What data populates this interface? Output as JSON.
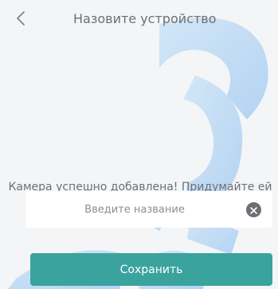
{
  "header": {
    "back_icon": "chevron-left-icon",
    "title": "Назовите устройство"
  },
  "main": {
    "message": "Камера успешно добавлена! Придумайте ей название."
  },
  "name_input": {
    "placeholder": "Введите название",
    "value": "",
    "clear_icon": "clear-x-icon"
  },
  "footer": {
    "save_label": "Сохранить"
  },
  "colors": {
    "background": "#f4f5f7",
    "accent": "#3aa39d",
    "text": "#6d6f75",
    "watermark": "#9cc8f2"
  }
}
